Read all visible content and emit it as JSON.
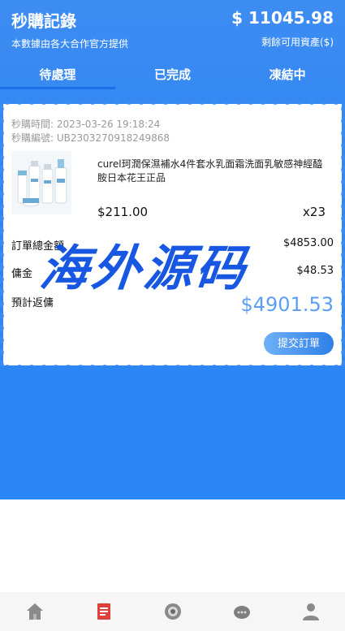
{
  "header": {
    "title": "秒購記錄",
    "subtitle": "本數據由各大合作官方提供",
    "balance": "$ 11045.98",
    "balance_label": "剩餘可用資產($)"
  },
  "tabs": [
    {
      "label": "待處理",
      "active": true
    },
    {
      "label": "已完成",
      "active": false
    },
    {
      "label": "凍結中",
      "active": false
    }
  ],
  "order": {
    "time": "秒購時間: 2023-03-26 19:18:24",
    "serial": "秒購編號: UB2303270918249868",
    "product_name": "curel珂潤保濕補水4件套水乳面霜洗面乳敏感神經醯胺日本花王正品",
    "price": "$211.00",
    "quantity": "x23",
    "total_label": "訂單總金額",
    "total_value": "$4853.00",
    "commission_label": "傭金",
    "commission_value": "$48.53",
    "estimate_label": "預計返傭",
    "estimate_value": "$4901.53",
    "submit_label": "提交訂單"
  },
  "watermark": "海外源码",
  "bottom_nav": [
    {
      "icon": "home-icon"
    },
    {
      "icon": "orders-icon"
    },
    {
      "icon": "grab-icon"
    },
    {
      "icon": "service-icon"
    },
    {
      "icon": "profile-icon"
    }
  ],
  "colors": {
    "primary": "#2f86f3",
    "estimate": "#5b9ef2",
    "watermark": "#0b4fe0"
  }
}
